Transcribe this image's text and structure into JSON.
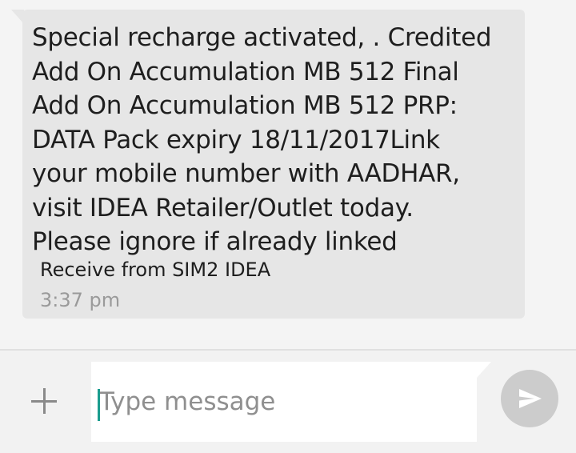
{
  "message": {
    "body": "Special recharge activated, .  Credited\nAdd On Accumulation MB 512 Final\nAdd On Accumulation MB 512 PRP:\nDATA Pack expiry 18/11/2017Link\nyour mobile number with AADHAR,\nvisit IDEA Retailer/Outlet today.\nPlease ignore if already linked",
    "sim_label": "Receive from SIM2 IDEA",
    "time": "3:37 pm"
  },
  "composer": {
    "placeholder": "Type message",
    "value": "",
    "add_icon": "plus-icon",
    "send_icon": "send-icon"
  },
  "colors": {
    "bubble": "#e6e6e6",
    "caret": "#1a9c8e",
    "send_button": "#cccccc"
  }
}
